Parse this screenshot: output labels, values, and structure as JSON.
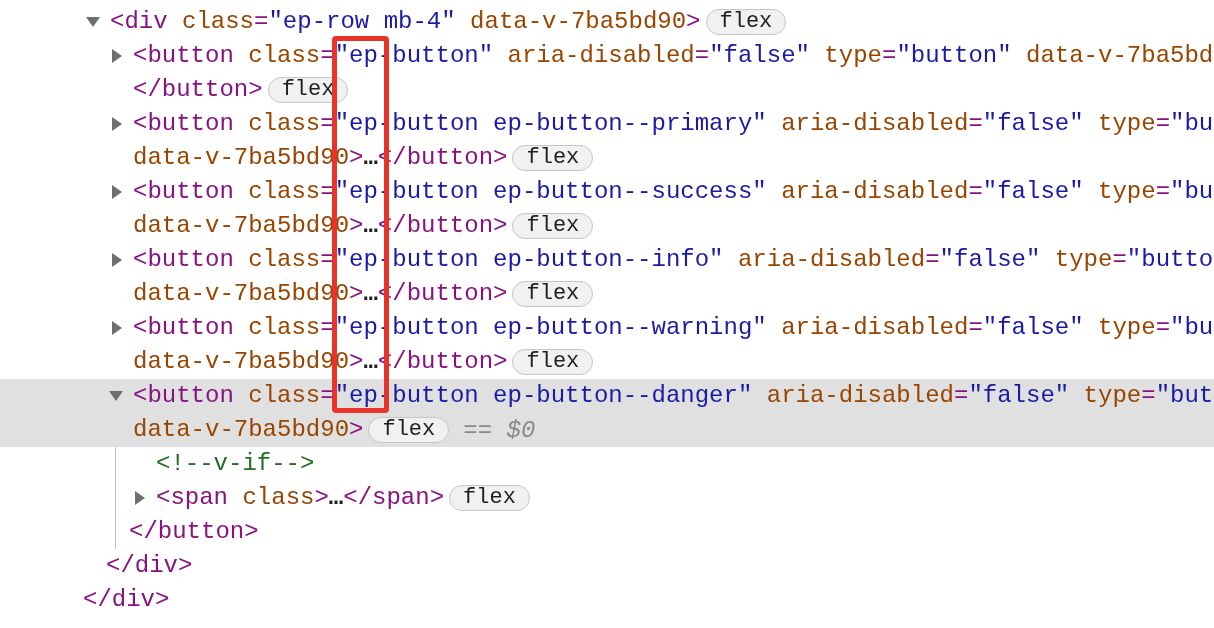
{
  "dom_tree": {
    "children": [
      {
        "expanded": true,
        "selected": false,
        "lines": [
          [
            {
              "kind": "tag",
              "text": "<div"
            },
            {
              "kind": "attr",
              "text": " class"
            },
            {
              "kind": "tag",
              "text": "="
            },
            {
              "kind": "value",
              "text": "\"ep-row mb-4\""
            },
            {
              "kind": "attr",
              "text": " data-v-7ba5bd90"
            },
            {
              "kind": "tag",
              "text": ">"
            }
          ]
        ],
        "badge": "flex",
        "children": [
          {
            "expanded": false,
            "selected": false,
            "lines": [
              [
                {
                  "kind": "tag",
                  "text": "<button"
                },
                {
                  "kind": "attr",
                  "text": " class"
                },
                {
                  "kind": "tag",
                  "text": "="
                },
                {
                  "kind": "value",
                  "text": "\"ep-button\""
                },
                {
                  "kind": "attr",
                  "text": " aria-disabled"
                },
                {
                  "kind": "tag",
                  "text": "="
                },
                {
                  "kind": "value",
                  "text": "\"false\""
                },
                {
                  "kind": "attr",
                  "text": " type"
                },
                {
                  "kind": "tag",
                  "text": "="
                },
                {
                  "kind": "value",
                  "text": "\"button\""
                },
                {
                  "kind": "attr",
                  "text": " data-v-7ba5bd"
                }
              ],
              [
                {
                  "kind": "tag",
                  "text": "</button>"
                }
              ]
            ],
            "badge": "flex"
          },
          {
            "expanded": false,
            "selected": false,
            "lines": [
              [
                {
                  "kind": "tag",
                  "text": "<button"
                },
                {
                  "kind": "attr",
                  "text": " class"
                },
                {
                  "kind": "tag",
                  "text": "="
                },
                {
                  "kind": "value",
                  "text": "\"ep-button ep-button--primary\""
                },
                {
                  "kind": "attr",
                  "text": " aria-disabled"
                },
                {
                  "kind": "tag",
                  "text": "="
                },
                {
                  "kind": "value",
                  "text": "\"false\""
                },
                {
                  "kind": "attr",
                  "text": " type"
                },
                {
                  "kind": "tag",
                  "text": "="
                },
                {
                  "kind": "value",
                  "text": "\"bu"
                }
              ],
              [
                {
                  "kind": "attr",
                  "text": "data-v-7ba5bd90"
                },
                {
                  "kind": "tag",
                  "text": ">"
                },
                {
                  "kind": "text",
                  "text": "…"
                },
                {
                  "kind": "tag",
                  "text": "</button>"
                }
              ]
            ],
            "badge": "flex"
          },
          {
            "expanded": false,
            "selected": false,
            "lines": [
              [
                {
                  "kind": "tag",
                  "text": "<button"
                },
                {
                  "kind": "attr",
                  "text": " class"
                },
                {
                  "kind": "tag",
                  "text": "="
                },
                {
                  "kind": "value",
                  "text": "\"ep-button ep-button--success\""
                },
                {
                  "kind": "attr",
                  "text": " aria-disabled"
                },
                {
                  "kind": "tag",
                  "text": "="
                },
                {
                  "kind": "value",
                  "text": "\"false\""
                },
                {
                  "kind": "attr",
                  "text": " type"
                },
                {
                  "kind": "tag",
                  "text": "="
                },
                {
                  "kind": "value",
                  "text": "\"bu"
                }
              ],
              [
                {
                  "kind": "attr",
                  "text": "data-v-7ba5bd90"
                },
                {
                  "kind": "tag",
                  "text": ">"
                },
                {
                  "kind": "text",
                  "text": "…"
                },
                {
                  "kind": "tag",
                  "text": "</button>"
                }
              ]
            ],
            "badge": "flex"
          },
          {
            "expanded": false,
            "selected": false,
            "lines": [
              [
                {
                  "kind": "tag",
                  "text": "<button"
                },
                {
                  "kind": "attr",
                  "text": " class"
                },
                {
                  "kind": "tag",
                  "text": "="
                },
                {
                  "kind": "value",
                  "text": "\"ep-button ep-button--info\""
                },
                {
                  "kind": "attr",
                  "text": " aria-disabled"
                },
                {
                  "kind": "tag",
                  "text": "="
                },
                {
                  "kind": "value",
                  "text": "\"false\""
                },
                {
                  "kind": "attr",
                  "text": " type"
                },
                {
                  "kind": "tag",
                  "text": "="
                },
                {
                  "kind": "value",
                  "text": "\"butto"
                }
              ],
              [
                {
                  "kind": "attr",
                  "text": "data-v-7ba5bd90"
                },
                {
                  "kind": "tag",
                  "text": ">"
                },
                {
                  "kind": "text",
                  "text": "…"
                },
                {
                  "kind": "tag",
                  "text": "</button>"
                }
              ]
            ],
            "badge": "flex"
          },
          {
            "expanded": false,
            "selected": false,
            "lines": [
              [
                {
                  "kind": "tag",
                  "text": "<button"
                },
                {
                  "kind": "attr",
                  "text": " class"
                },
                {
                  "kind": "tag",
                  "text": "="
                },
                {
                  "kind": "value",
                  "text": "\"ep-button ep-button--warning\""
                },
                {
                  "kind": "attr",
                  "text": " aria-disabled"
                },
                {
                  "kind": "tag",
                  "text": "="
                },
                {
                  "kind": "value",
                  "text": "\"false\""
                },
                {
                  "kind": "attr",
                  "text": " type"
                },
                {
                  "kind": "tag",
                  "text": "="
                },
                {
                  "kind": "value",
                  "text": "\"bu"
                }
              ],
              [
                {
                  "kind": "attr",
                  "text": "data-v-7ba5bd90"
                },
                {
                  "kind": "tag",
                  "text": ">"
                },
                {
                  "kind": "text",
                  "text": "…"
                },
                {
                  "kind": "tag",
                  "text": "</button>"
                }
              ]
            ],
            "badge": "flex"
          },
          {
            "expanded": true,
            "selected": true,
            "lines": [
              [
                {
                  "kind": "tag",
                  "text": "<button"
                },
                {
                  "kind": "attr",
                  "text": " class"
                },
                {
                  "kind": "tag",
                  "text": "="
                },
                {
                  "kind": "value",
                  "text": "\"ep-button ep-button--danger\""
                },
                {
                  "kind": "attr",
                  "text": " aria-disabled"
                },
                {
                  "kind": "tag",
                  "text": "="
                },
                {
                  "kind": "value",
                  "text": "\"false\""
                },
                {
                  "kind": "attr",
                  "text": " type"
                },
                {
                  "kind": "tag",
                  "text": "="
                },
                {
                  "kind": "value",
                  "text": "\"but"
                }
              ],
              [
                {
                  "kind": "attr",
                  "text": "data-v-7ba5bd90"
                },
                {
                  "kind": "tag",
                  "text": ">"
                }
              ]
            ],
            "badge": "flex",
            "marker": "== *$0*",
            "children": [
              {
                "selected": false,
                "lines": [
                  [
                    {
                      "kind": "comment",
                      "text": "<!--v-if-->"
                    }
                  ]
                ]
              },
              {
                "expanded": false,
                "selected": false,
                "lines": [
                  [
                    {
                      "kind": "tag",
                      "text": "<span"
                    },
                    {
                      "kind": "attr",
                      "text": " class"
                    },
                    {
                      "kind": "tag",
                      "text": ">"
                    },
                    {
                      "kind": "text",
                      "text": "…"
                    },
                    {
                      "kind": "tag",
                      "text": "</span>"
                    }
                  ]
                ],
                "badge": "flex"
              }
            ],
            "closing": [
              {
                "kind": "tag",
                "text": "</button>"
              }
            ]
          }
        ],
        "closing": [
          {
            "kind": "tag",
            "text": "</div>"
          }
        ]
      }
    ],
    "closing": [
      {
        "kind": "tag",
        "text": "</div>"
      }
    ]
  },
  "annotations": [
    {
      "kind": "rectangle"
    }
  ]
}
